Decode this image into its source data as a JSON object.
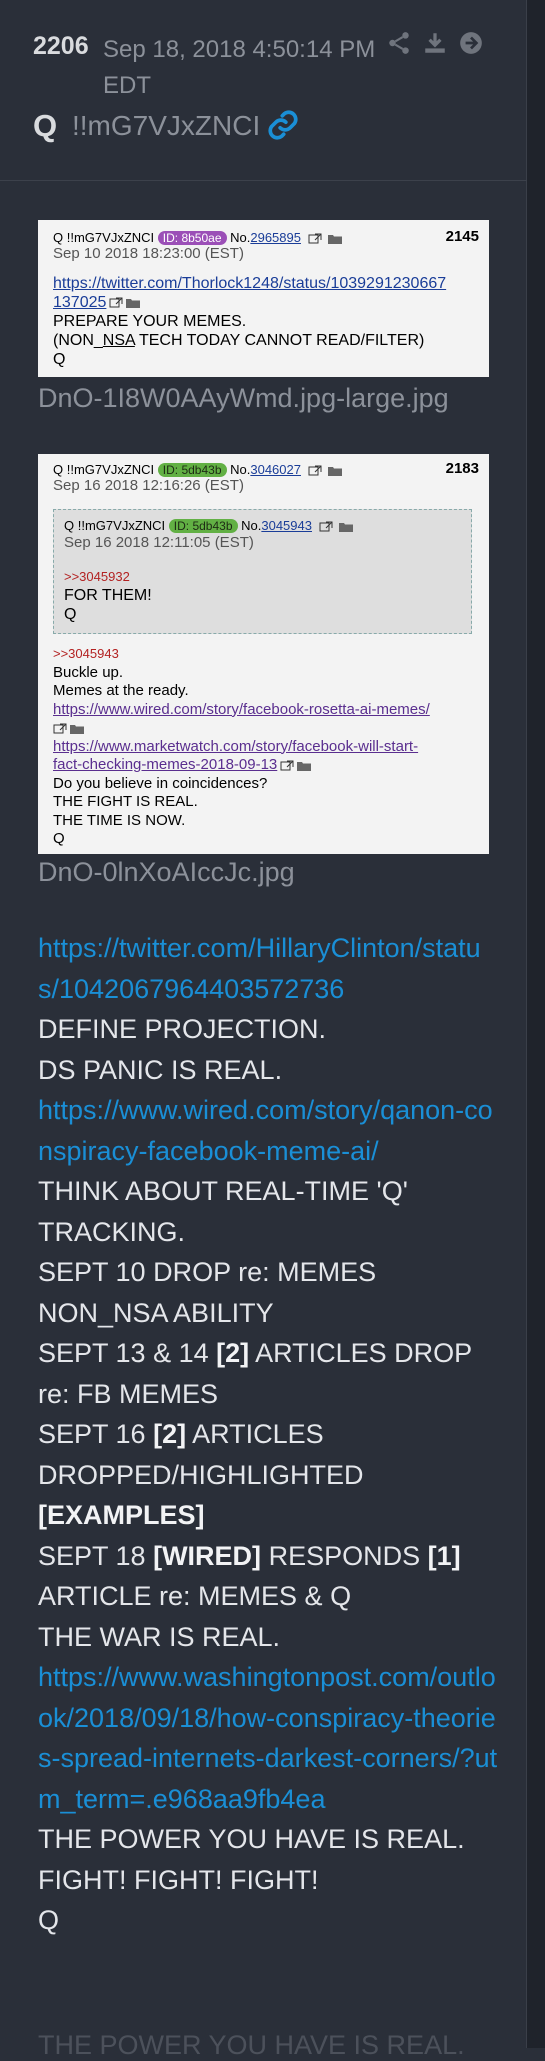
{
  "header": {
    "post_number": "2206",
    "date_line1": "Sep 18, 2018 4:50:14 PM",
    "date_line2": "EDT",
    "author_name": "Q",
    "author_trip": "!!mG7VJxZNCI",
    "icons": [
      "share-icon",
      "download-icon",
      "arrow-right-circle-icon",
      "link-icon"
    ]
  },
  "card1": {
    "name": "Q",
    "trip": "!!mG7VJxZNCI",
    "id_label": "ID: 8b50ae",
    "no_prefix": "No.",
    "no_value": "2965895",
    "number": "2145",
    "date": "Sep 10 2018 18:23:00 (EST)",
    "link_part1": "https://twitter.com/Thorlock1248/status/1039291230667",
    "link_part2": "137025",
    "line1": "PREPARE YOUR MEMES.",
    "line2_pre": "(NON_",
    "line2_ul": "NSA",
    "line2_post": " TECH TODAY CANNOT READ/FILTER)",
    "line3": "Q"
  },
  "filename1": "DnO-1I8W0AAyWmd.jpg-large.jpg",
  "card2": {
    "name": "Q",
    "trip": "!!mG7VJxZNCI",
    "id_label": "ID: 5db43b",
    "no_prefix": "No.",
    "no_value": "3046027",
    "number": "2183",
    "date": "Sep 16 2018 12:16:26 (EST)",
    "inner": {
      "name": "Q",
      "trip": "!!mG7VJxZNCI",
      "id_label": "ID: 5db43b",
      "no_prefix": "No.",
      "no_value": "3045943",
      "date": "Sep 16 2018 12:11:05 (EST)",
      "reply": ">>3045932",
      "line1": "FOR THEM!",
      "line2": "Q"
    },
    "reply": ">>3045943",
    "line1": "Buckle up.",
    "line2": "Memes at the ready.",
    "link1": "https://www.wired.com/story/facebook-rosetta-ai-memes/",
    "link2a": "https://www.marketwatch.com/story/facebook-will-start-",
    "link2b": "fact-checking-memes-2018-09-13",
    "line3": "Do you believe in coincidences?",
    "line4": "THE FIGHT IS REAL.",
    "line5": "THE TIME IS NOW.",
    "line6": "Q"
  },
  "filename2": "DnO-0lnXoAIccJc.jpg",
  "main": {
    "link1": "https://twitter.com/HillaryClinton/status/1042067964403572736",
    "t1": "DEFINE PROJECTION.",
    "t2": "DS PANIC IS REAL.",
    "link2": "https://www.wired.com/story/qanon-conspiracy-facebook-meme-ai/",
    "t3": "THINK ABOUT REAL-TIME 'Q' TRACKING.",
    "t4": "SEPT 10 DROP re: MEMES",
    "t5": "NON_NSA ABILITY",
    "t6a": "SEPT 13 & 14 ",
    "t6b": "[2]",
    "t6c": " ARTICLES DROP re: FB MEMES",
    "t7a": "SEPT 16 ",
    "t7b": "[2]",
    "t7c": " ARTICLES DROPPED/HIGHLIGHTED ",
    "t7d": "[EXAMPLES]",
    "t8a": "SEPT 18 ",
    "t8b": "[WIRED]",
    "t8c": " RESPONDS ",
    "t8d": "[1]",
    "t8e": " ARTICLE re: MEMES & Q",
    "t9": "THE WAR IS REAL.",
    "link3": "https://www.washingtonpost.com/outlook/2018/09/18/how-conspiracy-theories-spread-internets-darkest-corners/?utm_term=.e968aa9fb4ea",
    "t10": "THE POWER YOU HAVE IS REAL.",
    "t11": "FIGHT! FIGHT! FIGHT!",
    "t12": "Q",
    "t13": "THE POWER YOU HAVE IS REAL."
  }
}
